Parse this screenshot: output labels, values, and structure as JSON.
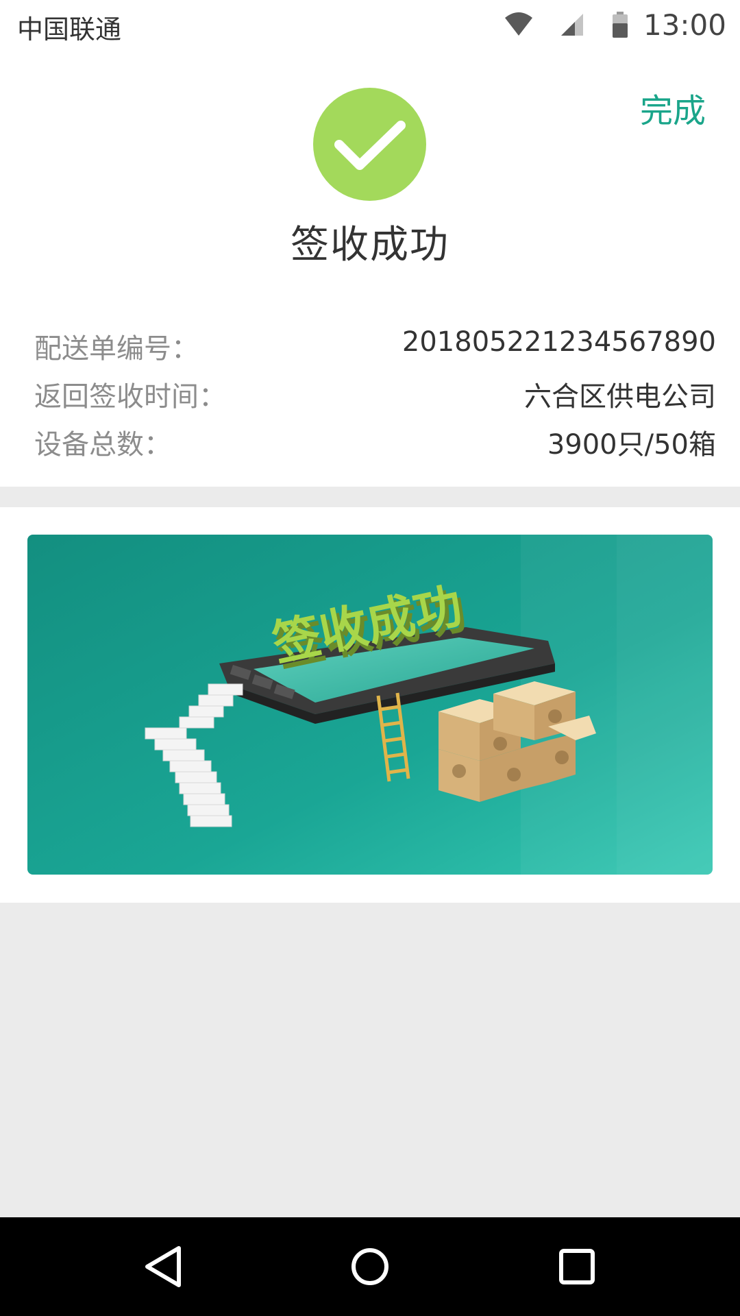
{
  "status_bar": {
    "carrier": "中国联通",
    "time": "13:00"
  },
  "header": {
    "done_label": "完成",
    "title": "签收成功"
  },
  "details": [
    {
      "label": "配送单编号：",
      "value": "201805221234567890"
    },
    {
      "label": "返回签收时间：",
      "value": "六合区供电公司"
    },
    {
      "label": "设备总数：",
      "value": "3900只/50箱"
    }
  ],
  "banner": {
    "text": "签收成功"
  },
  "nav": {
    "icons": [
      "back-icon",
      "home-icon",
      "recents-icon"
    ]
  },
  "colors": {
    "accent": "#1aa58a",
    "success": "#a3d95b",
    "banner_bg": "#1aa28f"
  }
}
